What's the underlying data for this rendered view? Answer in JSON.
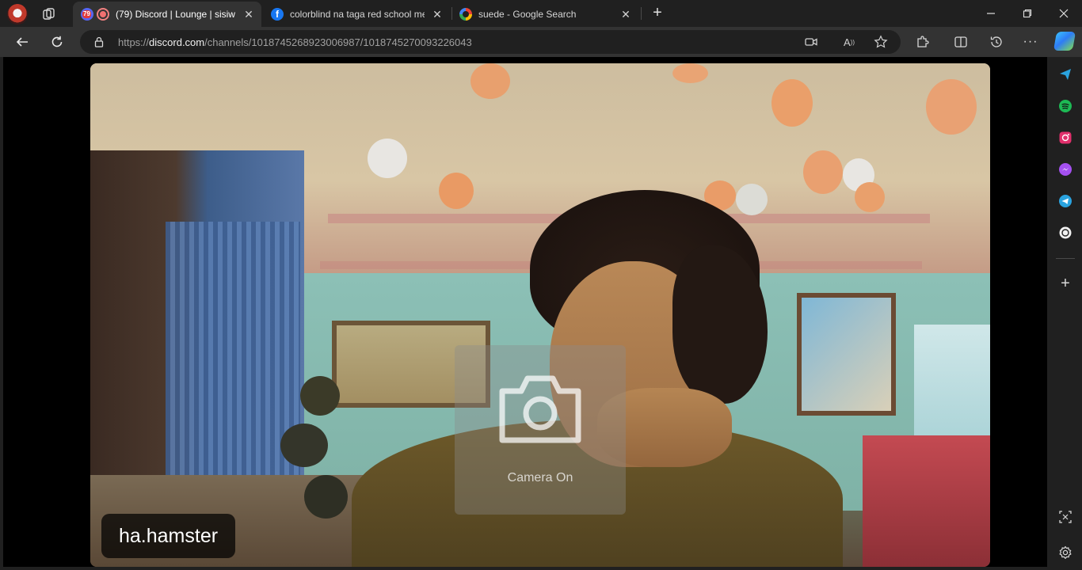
{
  "tabs": [
    {
      "title": "(79) Discord | Lounge | sisiw",
      "badge": "79",
      "favicon": "discord-icon",
      "recording": true,
      "active": true
    },
    {
      "title": "colorblind na taga red school me",
      "favicon": "facebook-icon",
      "active": false
    },
    {
      "title": "suede - Google Search",
      "favicon": "google-icon",
      "active": false
    }
  ],
  "address_bar": {
    "url_prefix": "https://",
    "url_domain": "discord.com",
    "url_path": "/channels/1018745268923006987/1018745270093226043"
  },
  "video": {
    "participant_name": "ha.hamster",
    "camera_overlay_label": "Camera On"
  },
  "sidebar": {
    "items": [
      "send-icon",
      "spotify-icon",
      "instagram-icon",
      "messenger-icon",
      "telegram-icon",
      "chatgpt-icon",
      "add-icon"
    ],
    "bottom": [
      "screenshot-icon",
      "settings-icon"
    ]
  },
  "colors": {
    "accent": "#2e7cf6",
    "discord_badge": "#e23b3b",
    "facebook": "#1877f2",
    "spotify": "#1db954",
    "instagram": "#e1306c",
    "telegram": "#2aa3df"
  }
}
